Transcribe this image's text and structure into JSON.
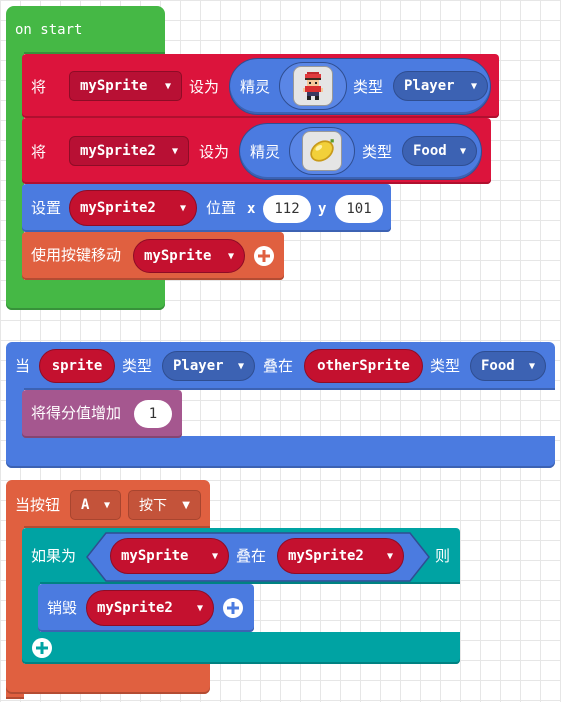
{
  "on_start": {
    "hat_label": "on start",
    "set1": {
      "set_word": "将",
      "var": "mySprite",
      "to_word": "设为",
      "sprite_word": "精灵",
      "kind_word": "类型",
      "kind": "Player",
      "sprite_icon": "player-pixel-icon"
    },
    "set2": {
      "set_word": "将",
      "var": "mySprite2",
      "to_word": "设为",
      "sprite_word": "精灵",
      "kind_word": "类型",
      "kind": "Food",
      "sprite_icon": "lemon-pixel-icon"
    },
    "position": {
      "set_word": "设置",
      "var": "mySprite2",
      "pos_word": "位置",
      "x_label": "x",
      "x_value": "112",
      "y_label": "y",
      "y_value": "101"
    },
    "move": {
      "label": "使用按键移动",
      "var": "mySprite"
    }
  },
  "overlap": {
    "when_word": "当",
    "sprite_var": "sprite",
    "kind_word": "类型",
    "kind1": "Player",
    "overlaps_word": "叠在",
    "other_var": "otherSprite",
    "kind_word2": "类型",
    "kind2": "Food",
    "change_score": {
      "label": "将得分值增加",
      "value": "1"
    }
  },
  "button_event": {
    "when_label": "当按钮",
    "button": "A",
    "action": "按下",
    "if_block": {
      "if_word": "如果为",
      "var1": "mySprite",
      "overlaps_word": "叠在",
      "var2": "mySprite2",
      "then_word": "则",
      "destroy": {
        "label": "销毁",
        "var": "mySprite2"
      }
    }
  },
  "colors": {
    "loops_green": "#45b845",
    "sprites_red": "#dc143c",
    "sprites_blue": "#4b7be0",
    "controller_orange": "#e06040",
    "info_purple": "#a5578f",
    "logic_teal": "#00a3a3"
  }
}
